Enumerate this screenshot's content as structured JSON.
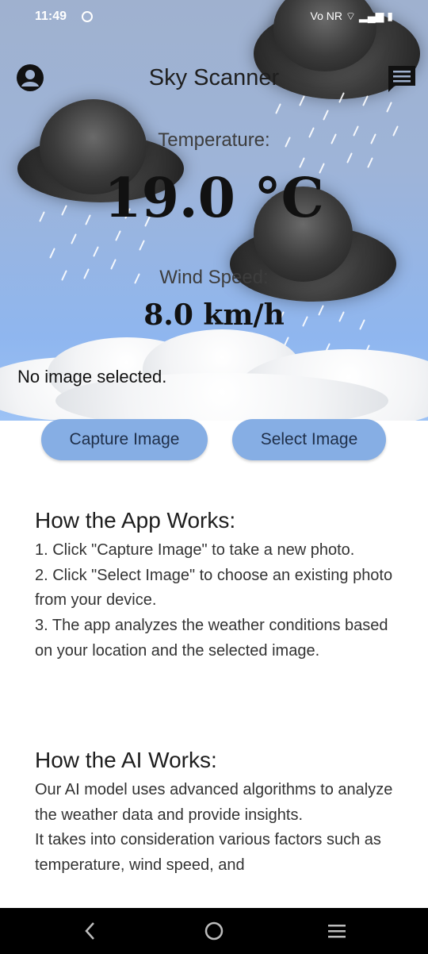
{
  "status_bar": {
    "time": "11:49",
    "right_icons_text": "Vo NR ⌔ ▂▄▆ ▮"
  },
  "app": {
    "title": "Sky Scanner",
    "temperature_label": "Temperature:",
    "temperature_value": "19.0 °C",
    "wind_label": "Wind Speed:",
    "wind_value": "8.0 km/h",
    "image_status": "No image selected."
  },
  "buttons": {
    "capture": "Capture Image",
    "select": "Select Image"
  },
  "how_app": {
    "heading": "How the App Works:",
    "lines": [
      "1. Click \"Capture Image\" to take a new photo.",
      "2. Click \"Select Image\" to choose an existing photo from your device.",
      "3. The app analyzes the weather conditions based on your location and the selected image."
    ]
  },
  "how_ai": {
    "heading": "How the AI Works:",
    "lines": [
      "Our AI model uses advanced algorithms to analyze the weather data and provide insights.",
      "It takes into consideration various factors such as temperature, wind speed, and"
    ]
  },
  "icons": [
    "profile-icon",
    "chat-icon",
    "back-icon",
    "home-icon",
    "recents-icon"
  ],
  "colors": {
    "button_bg": "#86aee4",
    "sky_top": "#9fb1cf",
    "sky_bottom": "#9cc2f5"
  }
}
